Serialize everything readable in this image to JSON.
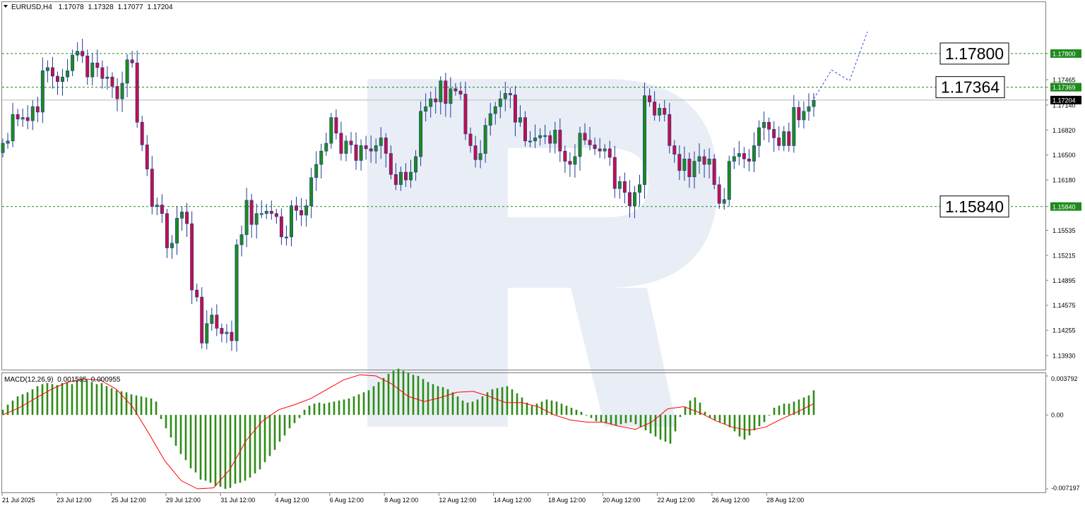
{
  "header": {
    "symbol": "EURUSD,H4",
    "open": "1.17078",
    "high": "1.17328",
    "low": "1.17077",
    "close": "1.17204"
  },
  "macd_header": {
    "label": "MACD(12,26,9)",
    "main": "0.001585",
    "signal": "0.000955"
  },
  "colors": {
    "bull": "#1e8a1e",
    "bear": "#c0104a",
    "level": "#1e8a1e",
    "forecast": "#2a4dcc",
    "macd_hist": "#2e8b16",
    "macd_signal": "#ff0000",
    "watermark": "#e9eef6"
  },
  "chart_data": [
    {
      "type": "candlestick",
      "title": "EURUSD,H4",
      "timeframe": "H4",
      "ylim": [
        1.1375,
        1.1845
      ],
      "y_ticks": [
        1.1393,
        1.14255,
        1.14575,
        1.14895,
        1.15215,
        1.15535,
        1.1584,
        1.1618,
        1.165,
        1.1682,
        1.1714,
        1.17204,
        1.17369,
        1.17465,
        1.178
      ],
      "y_tick_labels": [
        "1.13930",
        "1.14255",
        "1.14575",
        "1.14895",
        "1.15215",
        "1.15535",
        "1.15840",
        "1.16180",
        "1.16500",
        "1.16820",
        "1.17140",
        "1.17204",
        "1.17369",
        "1.17465",
        "1.17800"
      ],
      "x_labels": [
        "21 Jul 2025",
        "23 Jul 12:00",
        "25 Jul 12:00",
        "29 Jul 12:00",
        "31 Jul 12:00",
        "4 Aug 12:00",
        "6 Aug 12:00",
        "8 Aug 12:00",
        "12 Aug 12:00",
        "14 Aug 12:00",
        "18 Aug 12:00",
        "20 Aug 12:00",
        "22 Aug 12:00",
        "26 Aug 12:00",
        "28 Aug 12:00"
      ],
      "current_price": 1.17204,
      "levels": [
        {
          "price": 1.178,
          "label": "1.17800",
          "box": "1.17800"
        },
        {
          "price": 1.17369,
          "label": "1.17369",
          "box": "1.17364"
        },
        {
          "price": 1.1584,
          "label": "1.15840",
          "box": "1.15840"
        }
      ],
      "close_path": [
        1.1665,
        1.1668,
        1.1702,
        1.1696,
        1.1698,
        1.1694,
        1.1712,
        1.1705,
        1.1758,
        1.1762,
        1.1751,
        1.1744,
        1.175,
        1.1758,
        1.1778,
        1.1783,
        1.1777,
        1.175,
        1.1768,
        1.1762,
        1.1748,
        1.175,
        1.1738,
        1.1722,
        1.1742,
        1.1772,
        1.1768,
        1.1692,
        1.1663,
        1.1632,
        1.1584,
        1.1586,
        1.1575,
        1.1531,
        1.1537,
        1.1569,
        1.1577,
        1.1562,
        1.1477,
        1.1468,
        1.1409,
        1.1434,
        1.1445,
        1.1428,
        1.1421,
        1.1423,
        1.1412,
        1.1535,
        1.1548,
        1.1592,
        1.1561,
        1.1575,
        1.1575,
        1.1578,
        1.1575,
        1.1571,
        1.1545,
        1.1545,
        1.1585,
        1.1579,
        1.1573,
        1.1585,
        1.1621,
        1.1638,
        1.1655,
        1.1665,
        1.1698,
        1.1678,
        1.1652,
        1.1668,
        1.1663,
        1.1643,
        1.1662,
        1.1658,
        1.1655,
        1.1662,
        1.1672,
        1.1652,
        1.1625,
        1.1612,
        1.1628,
        1.1618,
        1.1628,
        1.1648,
        1.1706,
        1.1712,
        1.1722,
        1.1718,
        1.1745,
        1.1716,
        1.1735,
        1.1732,
        1.1728,
        1.1677,
        1.1662,
        1.1644,
        1.1652,
        1.1688,
        1.1703,
        1.1712,
        1.1722,
        1.1729,
        1.1727,
        1.1692,
        1.1698,
        1.1668,
        1.1668,
        1.1672,
        1.1675,
        1.1675,
        1.1665,
        1.1682,
        1.1655,
        1.1642,
        1.1638,
        1.1648,
        1.1678,
        1.1669,
        1.1663,
        1.1658,
        1.1655,
        1.1658,
        1.1647,
        1.1607,
        1.1616,
        1.1602,
        1.1585,
        1.1602,
        1.1612,
        1.1726,
        1.1718,
        1.1701,
        1.171,
        1.1702,
        1.1662,
        1.1651,
        1.163,
        1.1645,
        1.1622,
        1.1642,
        1.1648,
        1.1638,
        1.1645,
        1.1612,
        1.1588,
        1.1593,
        1.1642,
        1.1648,
        1.1652,
        1.1645,
        1.1642,
        1.1662,
        1.1685,
        1.1692,
        1.1683,
        1.1672,
        1.1662,
        1.168,
        1.1662,
        1.1711,
        1.1695,
        1.1706,
        1.1712,
        1.172
      ],
      "forecast": [
        1.1722,
        1.1759,
        1.1745,
        1.1808
      ]
    },
    {
      "type": "bar",
      "title": "MACD(12,26,9)",
      "ylim": [
        -0.007197,
        0.003792
      ],
      "y_ticks": [
        0.003792,
        0.0,
        -0.007197
      ],
      "y_tick_labels": [
        "0.003792",
        "0.00",
        "-0.007197"
      ],
      "histogram": [
        0.0005,
        0.001,
        0.0014,
        0.0018,
        0.002,
        0.0022,
        0.0025,
        0.0028,
        0.003,
        0.0031,
        0.003,
        0.0029,
        0.0031,
        0.0032,
        0.003,
        0.0033,
        0.0035,
        0.0034,
        0.0032,
        0.003,
        0.0031,
        0.0028,
        0.0026,
        0.0024,
        0.0023,
        0.0022,
        0.002,
        0.0019,
        0.0018,
        0.0017,
        0.0016,
        0.0013,
        -0.0004,
        -0.0013,
        -0.0022,
        -0.003,
        -0.0038,
        -0.0044,
        -0.0052,
        -0.0056,
        -0.0063,
        -0.0064,
        -0.0066,
        -0.0069,
        -0.007,
        -0.0072,
        -0.0071,
        -0.0067,
        -0.0066,
        -0.0064,
        -0.0061,
        -0.0057,
        -0.0053,
        -0.0046,
        -0.004,
        -0.0034,
        -0.0026,
        -0.002,
        -0.0013,
        -0.0008,
        -0.0003,
        0.0005,
        0.0009,
        0.0011,
        0.0012,
        0.0011,
        0.0012,
        0.0013,
        0.0014,
        0.0015,
        0.0016,
        0.0018,
        0.002,
        0.0022,
        0.0024,
        0.0028,
        0.0032,
        0.0036,
        0.004,
        0.0043,
        0.0045,
        0.0043,
        0.0041,
        0.0039,
        0.0038,
        0.0035,
        0.0032,
        0.003,
        0.0028,
        0.0027,
        0.0025,
        0.0022,
        0.0018,
        0.0014,
        0.0012,
        0.0013,
        0.0015,
        0.0018,
        0.0022,
        0.0025,
        0.0026,
        0.0027,
        0.0028,
        0.0025,
        0.0021,
        0.0017,
        0.0012,
        0.0009,
        0.0011,
        0.0013,
        0.0015,
        0.0014,
        0.0013,
        0.0011,
        0.0009,
        0.0007,
        0.0005,
        0.0003,
        0.0,
        -0.0003,
        -0.0006,
        -0.0007,
        -0.0008,
        -0.0009,
        -0.001,
        -0.0009,
        -0.0008,
        -0.0007,
        -0.0009,
        -0.0012,
        -0.0015,
        -0.0018,
        -0.0021,
        -0.0024,
        -0.0026,
        -0.0028,
        -0.0016,
        -0.0002,
        0.0008,
        0.0014,
        0.0017,
        0.0012,
        0.0003,
        -0.0003,
        -0.0005,
        -0.0007,
        -0.0009,
        -0.0012,
        -0.0016,
        -0.0021,
        -0.0024,
        -0.002,
        -0.0015,
        -0.0011,
        -0.0007,
        0.0,
        0.0007,
        0.0009,
        0.0011,
        0.0011,
        0.0013,
        0.0015,
        0.0017,
        0.0019,
        0.0024
      ],
      "signal_path": [
        0.0,
        0.0007,
        0.0016,
        0.0025,
        0.0032,
        0.0035,
        0.0034,
        0.0025,
        0.0008,
        -0.0018,
        -0.0045,
        -0.0064,
        -0.0072,
        -0.0071,
        -0.0053,
        -0.0025,
        -0.0006,
        0.0005,
        0.001,
        0.0016,
        0.0025,
        0.0034,
        0.0039,
        0.0038,
        0.003,
        0.0018,
        0.0013,
        0.0017,
        0.0022,
        0.0023,
        0.0018,
        0.0012,
        0.0012,
        0.0008,
        0.0,
        -0.0005,
        -0.0007,
        -0.0007,
        -0.0011,
        -0.0014,
        -0.0007,
        0.0006,
        0.0008,
        0.0002,
        -0.0006,
        -0.0012,
        -0.0015,
        -0.0012,
        -0.0004,
        0.0003,
        0.0011
      ]
    }
  ]
}
